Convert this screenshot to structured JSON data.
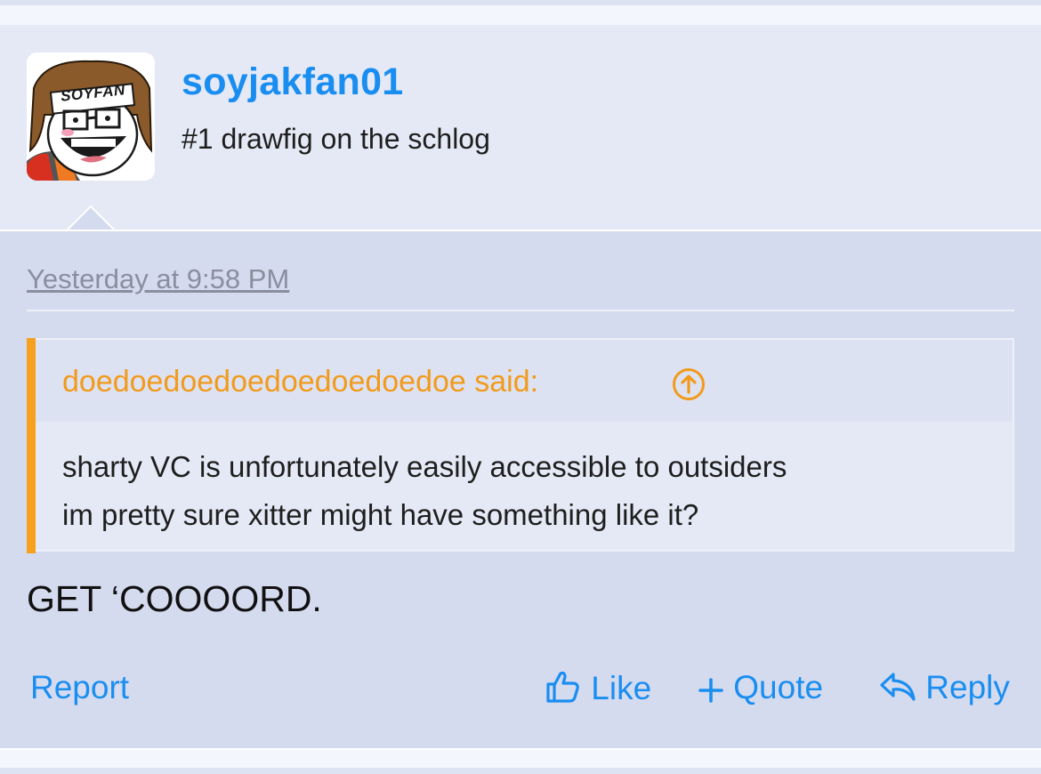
{
  "post": {
    "author": {
      "username": "soyjakfan01",
      "user_title": "#1 drawfig on the schlog",
      "avatar_text": "SOYFAN"
    },
    "timestamp": "Yesterday at 9:58 PM",
    "quote": {
      "author_line": "doedoedoedoedoedoedoedoe said:",
      "lines": [
        "sharty VC is unfortunately easily accessible to outsiders",
        "im pretty sure xitter might have something like it?"
      ]
    },
    "message": "GET ‘COOOORD.",
    "actions": {
      "report": "Report",
      "like": "Like",
      "quote": "Quote",
      "reply": "Reply"
    }
  },
  "colors": {
    "link": "#1a8ef0",
    "quote_accent": "#f5a11e",
    "header_bg": "#e5e9f6",
    "body_bg": "#d5dbef"
  }
}
